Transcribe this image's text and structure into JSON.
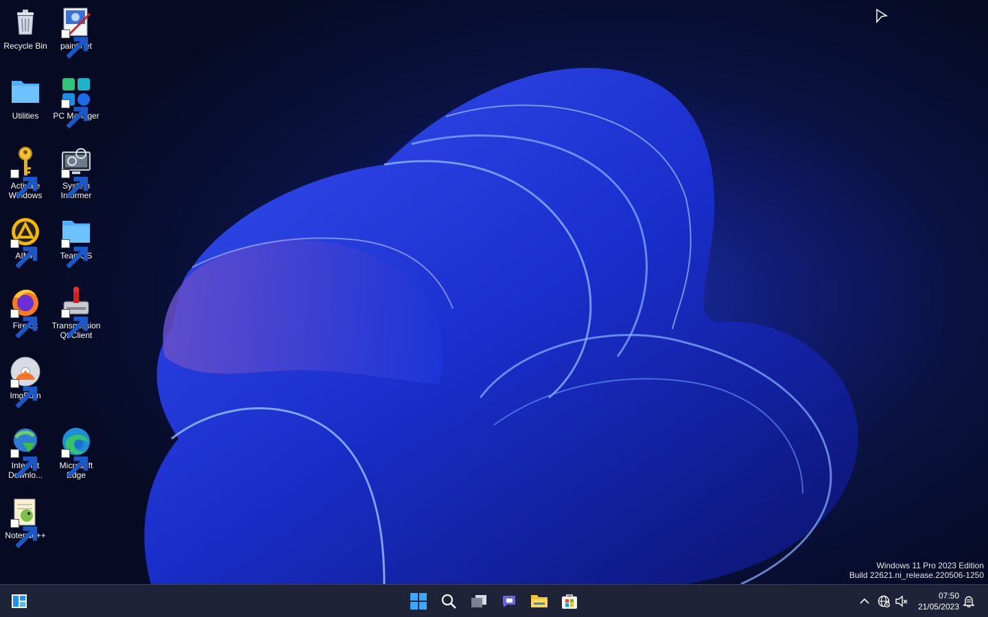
{
  "desktop": {
    "icons": [
      {
        "id": "recycle-bin",
        "label": "Recycle Bin"
      },
      {
        "id": "paint-net",
        "label": "paint.net"
      },
      {
        "id": "utilities",
        "label": "Utilities"
      },
      {
        "id": "pc-manager",
        "label": "PC Manager"
      },
      {
        "id": "activate-windows",
        "label": "Activate Windows"
      },
      {
        "id": "system-informer",
        "label": "System Informer"
      },
      {
        "id": "aimp",
        "label": "AIMP"
      },
      {
        "id": "teamos",
        "label": "TeamOS"
      },
      {
        "id": "firefox",
        "label": "Firefox"
      },
      {
        "id": "transmission",
        "label": "Transmission Qt Client"
      },
      {
        "id": "imgburn",
        "label": "ImgBurn"
      },
      {
        "id": "internet-download",
        "label": "Internet Downlo..."
      },
      {
        "id": "microsoft-edge",
        "label": "Microsoft Edge"
      },
      {
        "id": "notepadpp",
        "label": "Notepad++"
      }
    ]
  },
  "watermark": {
    "line1": "Windows 11 Pro 2023 Edition",
    "line2": "Build 22621.ni_release.220506-1250"
  },
  "taskbar": {
    "left_icon": "widgets-icon",
    "center_icons": [
      "start-icon",
      "search-icon",
      "task-view-icon",
      "teams-chat-icon",
      "file-explorer-icon",
      "microsoft-store-icon"
    ],
    "tray": {
      "time": "07:50",
      "date": "21/05/2023",
      "icons": [
        "chevron-up-icon",
        "network-icon",
        "volume-muted-icon",
        "notification-icon"
      ]
    }
  },
  "colors": {
    "wallpaper_accent": "#1e3cff",
    "taskbar_bg": "#202438"
  }
}
